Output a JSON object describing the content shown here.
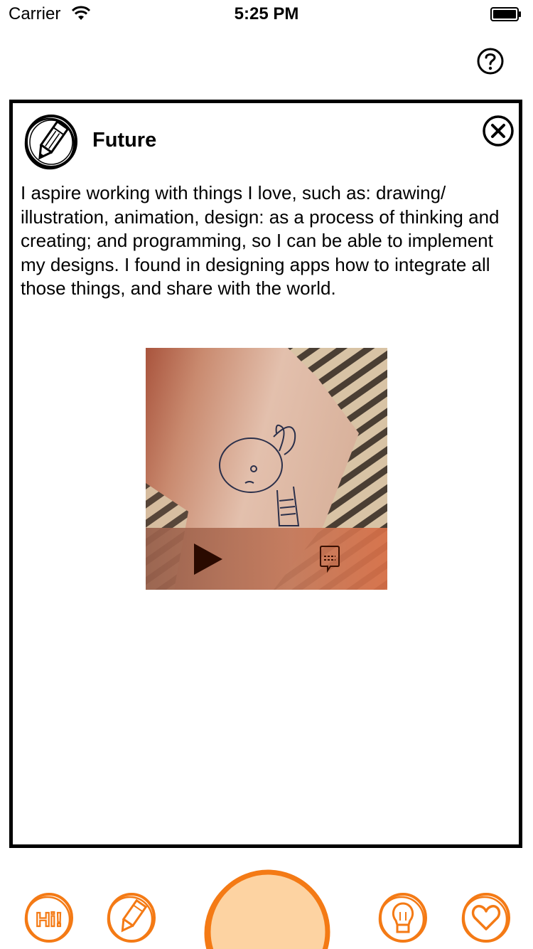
{
  "status_bar": {
    "carrier": "Carrier",
    "time": "5:25 PM"
  },
  "card": {
    "title": "Future",
    "body": "I aspire working with things I love, such as: drawing/ illustration, animation, design: as a process of thinking and creating; and programming, so I can be able to implement my designs. I found in designing apps how to integrate all those things, and share with the world."
  },
  "icons": {
    "help": "question-icon",
    "close": "close-icon",
    "card": "pencil-icon",
    "play": "play-icon",
    "captions": "captions-icon"
  },
  "bottom_nav": {
    "hi_label": "Hi!",
    "items": [
      "hi-icon",
      "pencil-icon",
      "center-button",
      "lightbulb-icon",
      "heart-icon"
    ]
  },
  "colors": {
    "accent": "#f47a15",
    "center_fill": "#fdd3a2",
    "card_border": "#000000",
    "controls": "#b97356"
  }
}
